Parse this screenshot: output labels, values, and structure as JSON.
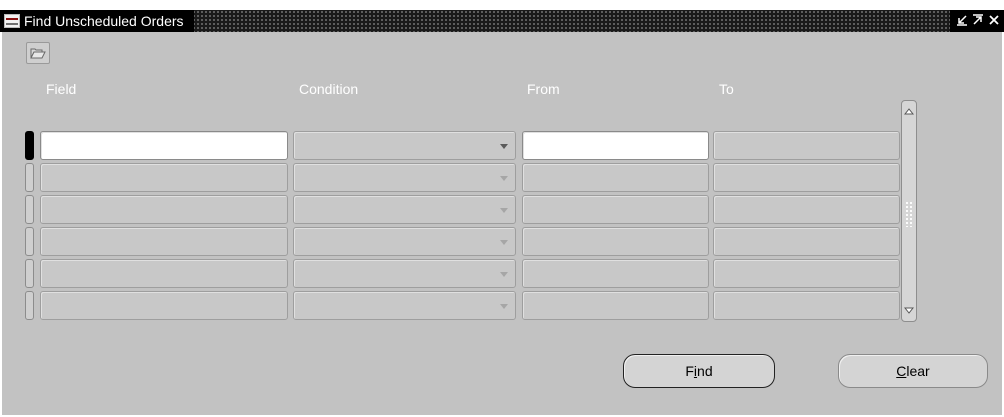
{
  "window": {
    "title": "Find Unscheduled Orders",
    "controls": [
      "minimize",
      "maximize",
      "close"
    ]
  },
  "toolbar": {
    "open_icon": "folder-open-icon"
  },
  "table": {
    "columns": [
      "Field",
      "Condition",
      "From",
      "To"
    ],
    "rows": [
      {
        "field": "",
        "condition": "",
        "from": "",
        "to": ""
      },
      {
        "field": "",
        "condition": "",
        "from": "",
        "to": ""
      },
      {
        "field": "",
        "condition": "",
        "from": "",
        "to": ""
      },
      {
        "field": "",
        "condition": "",
        "from": "",
        "to": ""
      },
      {
        "field": "",
        "condition": "",
        "from": "",
        "to": ""
      },
      {
        "field": "",
        "condition": "",
        "from": "",
        "to": ""
      }
    ],
    "active_row": 1
  },
  "buttons": {
    "find": {
      "pre": "F",
      "mnemonic": "i",
      "post": "nd"
    },
    "clear": {
      "pre": "",
      "mnemonic": "C",
      "post": "lear"
    }
  },
  "colors": {
    "client_bg": "#c2c2c2",
    "titlebar_bg": "#000000",
    "active_cell": "#ffffff"
  }
}
